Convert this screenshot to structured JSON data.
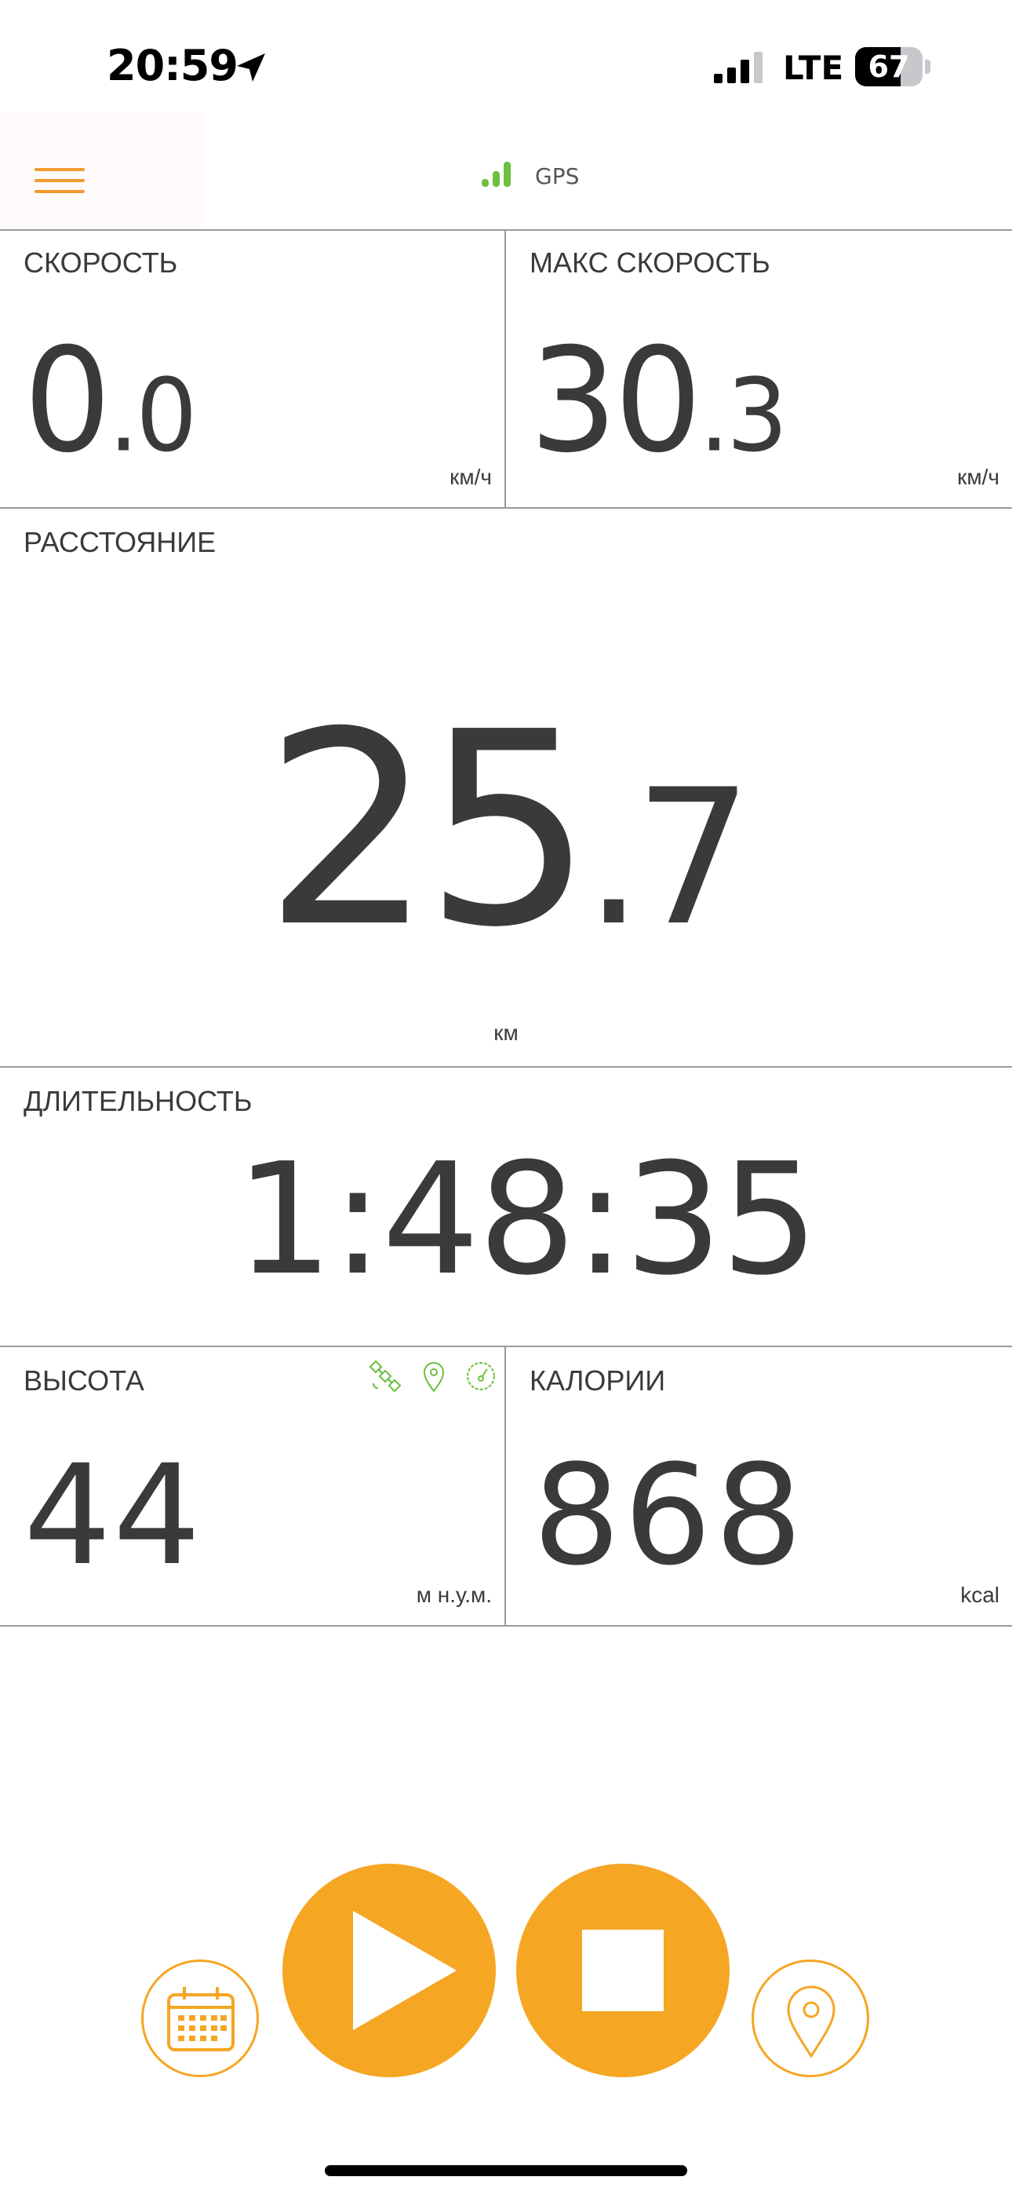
{
  "status_bar": {
    "time": "20:59",
    "network": "LTE",
    "battery_level": "67",
    "battery_fraction": 0.67,
    "icons": [
      "location-arrow-icon",
      "cellular-signal-icon",
      "battery-icon"
    ]
  },
  "app_bar": {
    "menu_icon": "hamburger-menu-icon",
    "gps_label": "GPS",
    "gps_signal_icon": "signal-bars-icon"
  },
  "metrics": {
    "speed": {
      "title": "СКОРОСТЬ",
      "int": "0",
      "frac": "0",
      "unit": "км/ч"
    },
    "max_speed": {
      "title": "МАКС СКОРОСТЬ",
      "int": "30",
      "frac": "3",
      "unit": "км/ч"
    },
    "distance": {
      "title": "РАССТОЯНИЕ",
      "int": "25",
      "frac": "7",
      "unit": "км"
    },
    "duration": {
      "title": "ДЛИТЕЛЬНОСТЬ",
      "value": "1:48:35"
    },
    "altitude": {
      "title": "ВЫСОТА",
      "value": "44",
      "unit": "м н.у.м.",
      "source_icons": [
        "satellite-icon",
        "map-pin-icon",
        "barometer-icon"
      ]
    },
    "calories": {
      "title": "КАЛОРИИ",
      "value": "868",
      "unit": "kcal"
    }
  },
  "controls": {
    "calendar_icon": "calendar-icon",
    "play_icon": "play-icon",
    "stop_icon": "stop-icon",
    "location_icon": "map-pin-icon"
  },
  "colors": {
    "accent": "#f5a623",
    "gps_green": "#6cbf3f",
    "text": "#3a3a3c",
    "divider": "#9a9a9a"
  }
}
